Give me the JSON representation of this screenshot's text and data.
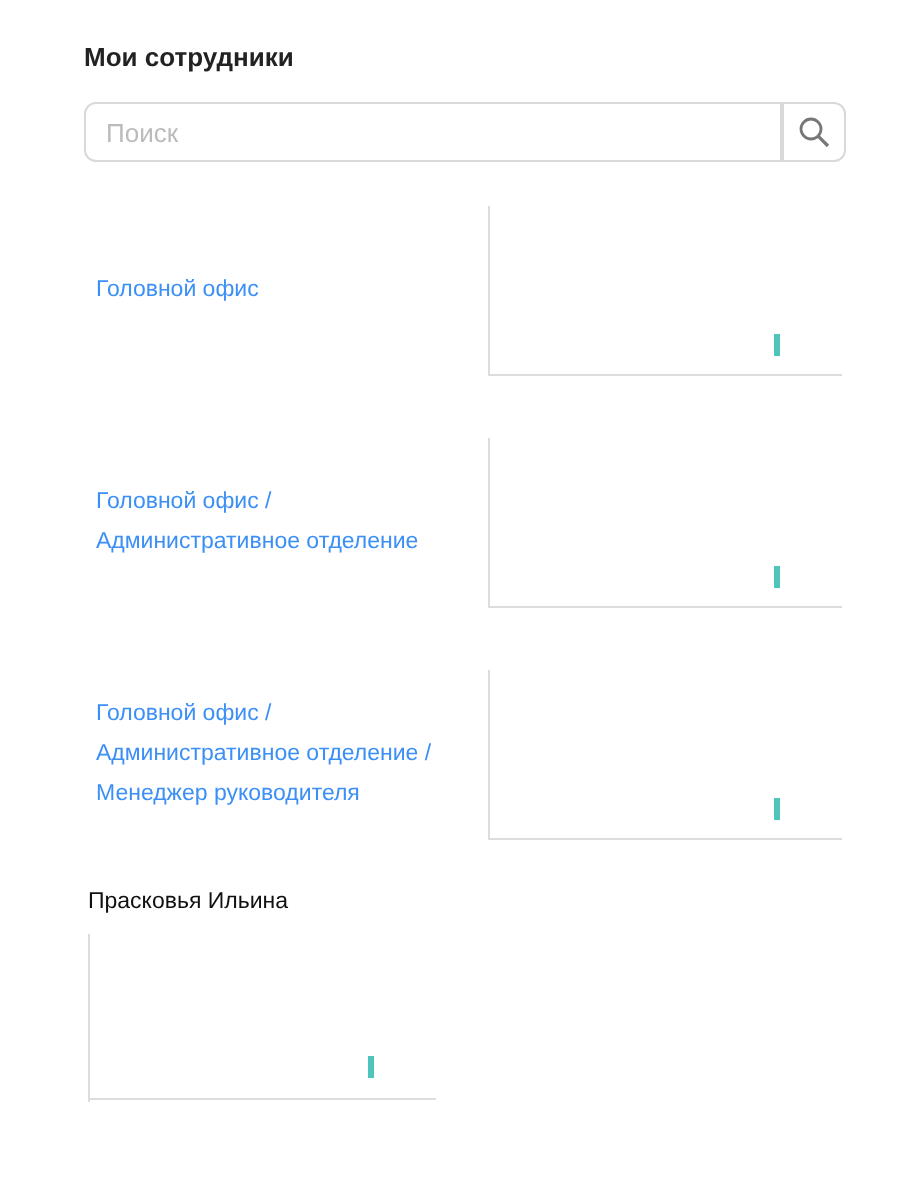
{
  "title": "Мои сотрудники",
  "search": {
    "placeholder": "Поиск"
  },
  "departments": [
    {
      "lines": [
        "Головной офис"
      ]
    },
    {
      "lines": [
        "Головной офис /",
        "Административное отделение"
      ]
    },
    {
      "lines": [
        "Головной офис /",
        "Административное отделение /",
        "Менеджер руководителя"
      ]
    }
  ],
  "employee": {
    "name": "Прасковья Ильина"
  }
}
